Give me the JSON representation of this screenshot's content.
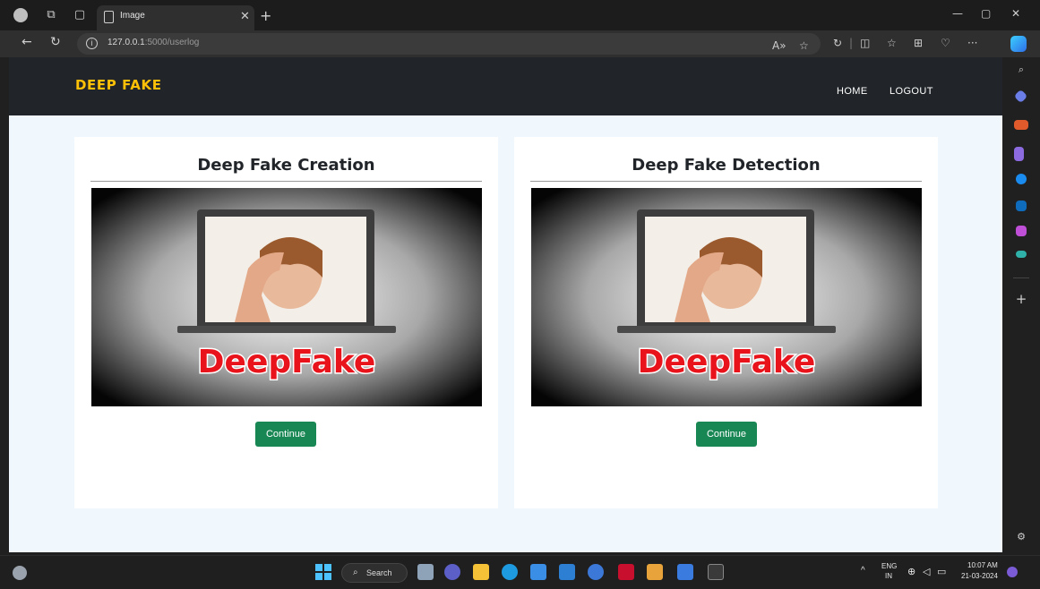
{
  "browser": {
    "tab_title": "Image",
    "url_host": "127.0.0.1",
    "url_path": ":5000/userlog"
  },
  "site": {
    "brand": "DEEP FAKE",
    "nav": {
      "home": "HOME",
      "logout": "LOGOUT"
    }
  },
  "cards": [
    {
      "title": "Deep Fake Creation",
      "image_caption": "DeepFake",
      "button": "Continue"
    },
    {
      "title": "Deep Fake Detection",
      "image_caption": "DeepFake",
      "button": "Continue"
    }
  ],
  "taskbar": {
    "search_label": "Search",
    "lang_top": "ENG",
    "lang_bottom": "IN",
    "time": "10:07 AM",
    "date": "21-03-2024"
  },
  "colors": {
    "brand": "#ffc107",
    "navbar": "#212529",
    "page_bg": "#f0f7fd",
    "button": "#198754",
    "caption_red": "#e8131b"
  },
  "icons": {
    "close": "close-icon",
    "new_tab": "plus-icon",
    "back": "arrow-left-icon",
    "refresh": "refresh-icon",
    "info": "info-icon",
    "favorite": "star-icon"
  }
}
